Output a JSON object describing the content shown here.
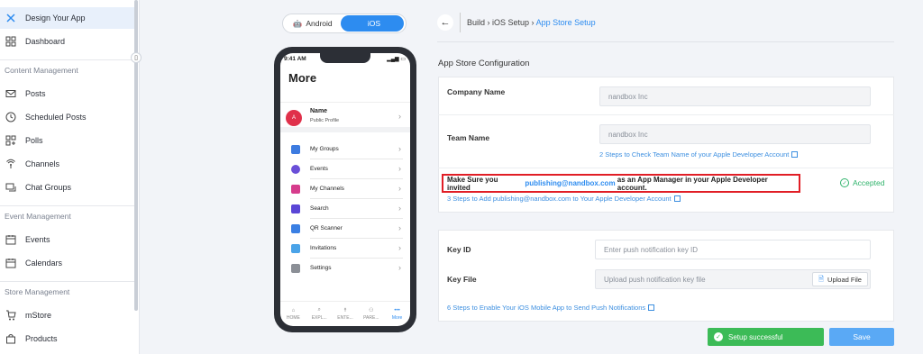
{
  "sidebar": {
    "items": [
      {
        "label": "Design Your App",
        "icon": "design-icon"
      },
      {
        "label": "Dashboard",
        "icon": "dashboard-icon"
      },
      {
        "label": "Posts",
        "icon": "mail-icon"
      },
      {
        "label": "Scheduled Posts",
        "icon": "clock-icon"
      },
      {
        "label": "Polls",
        "icon": "polls-icon"
      },
      {
        "label": "Channels",
        "icon": "broadcast-icon"
      },
      {
        "label": "Chat Groups",
        "icon": "chat-icon"
      },
      {
        "label": "Events",
        "icon": "calendar-icon"
      },
      {
        "label": "Calendars",
        "icon": "calendar-icon"
      },
      {
        "label": "mStore",
        "icon": "cart-icon"
      },
      {
        "label": "Products",
        "icon": "bag-icon"
      }
    ],
    "sections": {
      "content": "Content Management",
      "event": "Event Management",
      "store": "Store Management"
    }
  },
  "platform": {
    "android": "Android",
    "ios": "iOS",
    "selected": "iOS"
  },
  "phone": {
    "time": "9:41 AM",
    "title": "More",
    "profile": {
      "initial": "A",
      "name": "Name",
      "subtitle": "Public Profile"
    },
    "menu": [
      {
        "label": "My Groups",
        "color": "#3d7be0"
      },
      {
        "label": "Events",
        "color": "#6a4fd8"
      },
      {
        "label": "My Channels",
        "color": "#d63c8c"
      },
      {
        "label": "Search",
        "color": "#5a46d6"
      },
      {
        "label": "QR Scanner",
        "color": "#3a7fe3"
      },
      {
        "label": "Invitations",
        "color": "#4aa3e8"
      },
      {
        "label": "Settings",
        "color": "#8b8f96"
      }
    ],
    "tabs": [
      "HOME",
      "EXPL...",
      "ENTE...",
      "PARE...",
      "More"
    ]
  },
  "breadcrumb": {
    "build": "Build",
    "ios_setup": "iOS Setup",
    "current": "App Store Setup"
  },
  "section_title": "App Store Configuration",
  "config": {
    "company_label": "Company Name",
    "company_value": "nandbox Inc",
    "team_label": "Team Name",
    "team_value": "nandbox Inc",
    "team_link": "2 Steps to Check Team Name of your Apple Developer Account",
    "invite_prefix": "Make Sure you invited",
    "invite_email": "publishing@nandbox.com",
    "invite_suffix": "as an App Manager in your Apple Developer account.",
    "invite_link": "3 Steps to Add publishing@nandbox.com to Your Apple Developer Account",
    "accepted": "Accepted"
  },
  "push": {
    "key_id_label": "Key ID",
    "key_id_placeholder": "Enter push notification key ID",
    "key_file_label": "Key File",
    "key_file_placeholder": "Upload push notification key file",
    "upload_label": "Upload File",
    "push_link": "6 Steps to Enable Your iOS Mobile App to Send Push Notifications"
  },
  "footer": {
    "toast": "Setup successful",
    "save": "Save"
  },
  "colors": {
    "accent": "#2d8cf0",
    "success": "#3cbb57",
    "highlight": "#e11e26"
  }
}
